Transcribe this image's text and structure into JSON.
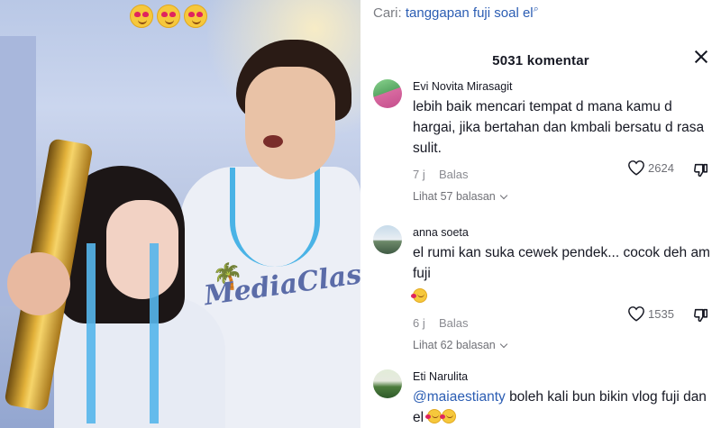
{
  "search": {
    "prefix": "Cari:",
    "query": "tanggapan fuji soal el",
    "icon": "search-icon"
  },
  "comments_header": {
    "count_label": "5031 komentar",
    "close_icon": "close-icon"
  },
  "video": {
    "overlay_emojis": [
      "heart-eyes-emoji",
      "heart-eyes-emoji",
      "heart-eyes-emoji"
    ],
    "shirt_text": "MediaClash"
  },
  "comments": [
    {
      "username": "Evi Novita Mirasagit",
      "text": "lebih baik mencari tempat d mana kamu d hargai, jika bertahan dan kmbali bersatu d rasa sulit.",
      "time": "7 j",
      "reply_label": "Balas",
      "likes": "2624",
      "view_replies": "Lihat 57 balasan"
    },
    {
      "username": "anna soeta",
      "text": "el rumi kan suka cewek pendek... cocok deh am fuji",
      "emoji_line": "smiling-face-with-hearts-emoji",
      "time": "6 j",
      "reply_label": "Balas",
      "likes": "1535",
      "view_replies": "Lihat 62 balasan"
    },
    {
      "username": "Eti Narulita",
      "mention": "@maiaestianty",
      "text": "boleh kali bun bikin vlog fuji dan el",
      "emoji_trailing": "smiling-face-with-hearts-emoji"
    }
  ],
  "colors": {
    "link_blue": "#2b5db3",
    "text_dark": "#161823",
    "text_grey": "#8a8b91"
  }
}
